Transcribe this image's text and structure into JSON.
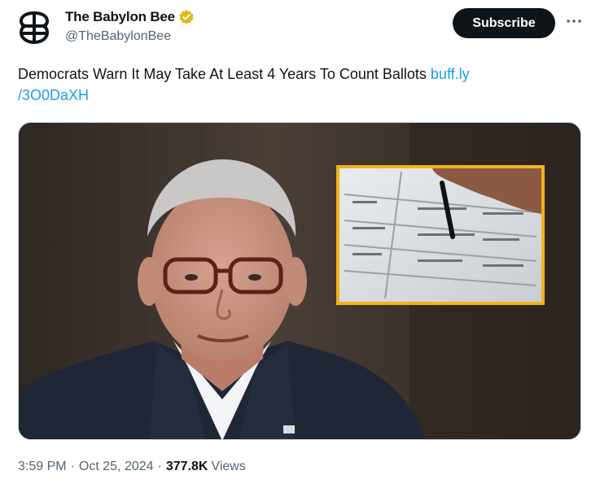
{
  "author": {
    "name": "The Babylon Bee",
    "handle": "@TheBabylonBee",
    "verified": true,
    "badge_color": "#e2b719",
    "avatar_icon": "bee-logo-icon"
  },
  "actions": {
    "subscribe_label": "Subscribe",
    "more_icon": "more-dots-icon"
  },
  "tweet": {
    "text": "Democrats Warn It May Take At Least 4 Years To Count Ballots ",
    "link_text": "buff.ly\n/3O0DaXH",
    "link_color": "#1d9bf0"
  },
  "media": {
    "type": "photo",
    "description_inset_border": "#f2b31b"
  },
  "meta": {
    "time": "3:59 PM",
    "separator1": "·",
    "date": "Oct 25, 2024",
    "separator2": "·",
    "views_count": "377.8K",
    "views_label": "Views"
  }
}
